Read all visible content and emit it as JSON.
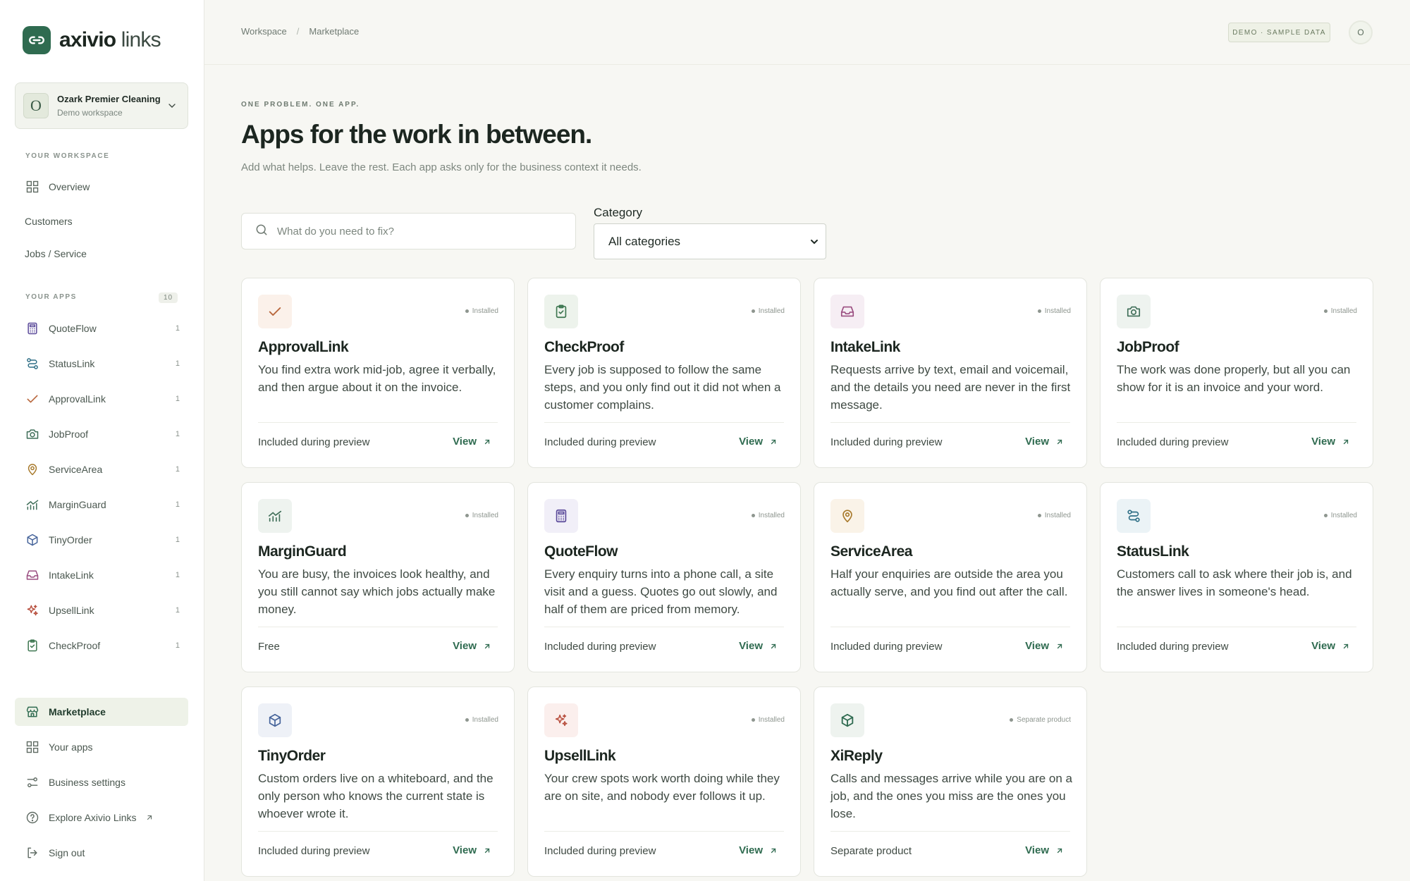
{
  "brand": {
    "bold": "axivio",
    "light": "links"
  },
  "workspace": {
    "initial": "O",
    "name": "Ozark Premier Cleaning",
    "sub": "Demo workspace"
  },
  "sidebar": {
    "section_workspace": "YOUR WORKSPACE",
    "overview": "Overview",
    "customers": "Customers",
    "jobs": "Jobs / Service",
    "section_apps": "YOUR APPS",
    "apps_count": "10",
    "apps": [
      {
        "label": "QuoteFlow",
        "count": "1",
        "icon": "calculator-icon"
      },
      {
        "label": "StatusLink",
        "count": "1",
        "icon": "route-icon"
      },
      {
        "label": "ApprovalLink",
        "count": "1",
        "icon": "check-icon"
      },
      {
        "label": "JobProof",
        "count": "1",
        "icon": "camera-icon"
      },
      {
        "label": "ServiceArea",
        "count": "1",
        "icon": "map-pin-icon"
      },
      {
        "label": "MarginGuard",
        "count": "1",
        "icon": "chart-icon"
      },
      {
        "label": "TinyOrder",
        "count": "1",
        "icon": "box-icon"
      },
      {
        "label": "IntakeLink",
        "count": "1",
        "icon": "inbox-icon"
      },
      {
        "label": "UpsellLink",
        "count": "1",
        "icon": "sparkles-icon"
      },
      {
        "label": "CheckProof",
        "count": "1",
        "icon": "clipboard-check-icon"
      }
    ],
    "marketplace": "Marketplace",
    "your_apps": "Your apps",
    "business_settings": "Business settings",
    "explore": "Explore Axivio Links",
    "sign_out": "Sign out"
  },
  "topbar": {
    "crumb_1": "Workspace",
    "crumb_sep": "/",
    "crumb_2": "Marketplace",
    "demo_badge": "DEMO · SAMPLE DATA",
    "user_initial": "O"
  },
  "main": {
    "eyebrow": "ONE PROBLEM. ONE APP.",
    "title": "Apps for the work in between.",
    "subtitle": "Add what helps. Leave the rest. Each app asks only for the business context it needs.",
    "search_placeholder": "What do you need to fix?",
    "category_label": "Category",
    "category_value": "All categories"
  },
  "colors": {
    "accent": "#2f6b50",
    "sidebar_active": "#eef2e8"
  },
  "cards": [
    {
      "name": "ApprovalLink",
      "status": "Installed",
      "desc": "You find extra work mid-job, agree it verbally, and then argue about it on the invoice.",
      "price": "Included during preview",
      "view": "View",
      "icon": "check-icon",
      "icon_bg": "#fbf1ea",
      "icon_color": "#b9683e"
    },
    {
      "name": "CheckProof",
      "status": "Installed",
      "desc": "Every job is supposed to follow the same steps, and you only find out it did not when a customer complains.",
      "price": "Included during preview",
      "view": "View",
      "icon": "clipboard-check-icon",
      "icon_bg": "#edf3ec",
      "icon_color": "#3d7650"
    },
    {
      "name": "IntakeLink",
      "status": "Installed",
      "desc": "Requests arrive by text, email and voicemail, and the details you need are never in the first message.",
      "price": "Included during preview",
      "view": "View",
      "icon": "inbox-icon",
      "icon_bg": "#f6eef4",
      "icon_color": "#9a4d80"
    },
    {
      "name": "JobProof",
      "status": "Installed",
      "desc": "The work was done properly, but all you can show for it is an invoice and your word.",
      "price": "Included during preview",
      "view": "View",
      "icon": "camera-icon",
      "icon_bg": "#eef3ef",
      "icon_color": "#3f6e58"
    },
    {
      "name": "MarginGuard",
      "status": "Installed",
      "desc": "You are busy, the invoices look healthy, and you still cannot say which jobs actually make money.",
      "price": "Free",
      "view": "View",
      "icon": "chart-icon",
      "icon_bg": "#eef3ef",
      "icon_color": "#3f6e58"
    },
    {
      "name": "QuoteFlow",
      "status": "Installed",
      "desc": "Every enquiry turns into a phone call, a site visit and a guess. Quotes go out slowly, and half of them are priced from memory.",
      "price": "Included during preview",
      "view": "View",
      "icon": "calculator-icon",
      "icon_bg": "#f1eff8",
      "icon_color": "#5b4a9a"
    },
    {
      "name": "ServiceArea",
      "status": "Installed",
      "desc": "Half your enquiries are outside the area you actually serve, and you find out after the call.",
      "price": "Included during preview",
      "view": "View",
      "icon": "map-pin-icon",
      "icon_bg": "#faf3e8",
      "icon_color": "#a87a2c"
    },
    {
      "name": "StatusLink",
      "status": "Installed",
      "desc": "Customers call to ask where their job is, and the answer lives in someone's head.",
      "price": "Included during preview",
      "view": "View",
      "icon": "route-icon",
      "icon_bg": "#ebf3f6",
      "icon_color": "#2f6f86"
    },
    {
      "name": "TinyOrder",
      "status": "Installed",
      "desc": "Custom orders live on a whiteboard, and the only person who knows the current state is whoever wrote it.",
      "price": "Included during preview",
      "view": "View",
      "icon": "box-icon",
      "icon_bg": "#eef1f7",
      "icon_color": "#45639a"
    },
    {
      "name": "UpsellLink",
      "status": "Installed",
      "desc": "Your crew spots work worth doing while they are on site, and nobody ever follows it up.",
      "price": "Included during preview",
      "view": "View",
      "icon": "sparkles-icon",
      "icon_bg": "#fbefed",
      "icon_color": "#b8503f"
    },
    {
      "name": "XiReply",
      "status": "Separate product",
      "desc": "Calls and messages arrive while you are on a job, and the ones you miss are the ones you lose.",
      "price": "Separate product",
      "view": "View",
      "icon": "cube-icon",
      "icon_bg": "#eef3ef",
      "icon_color": "#2f6b50"
    }
  ]
}
